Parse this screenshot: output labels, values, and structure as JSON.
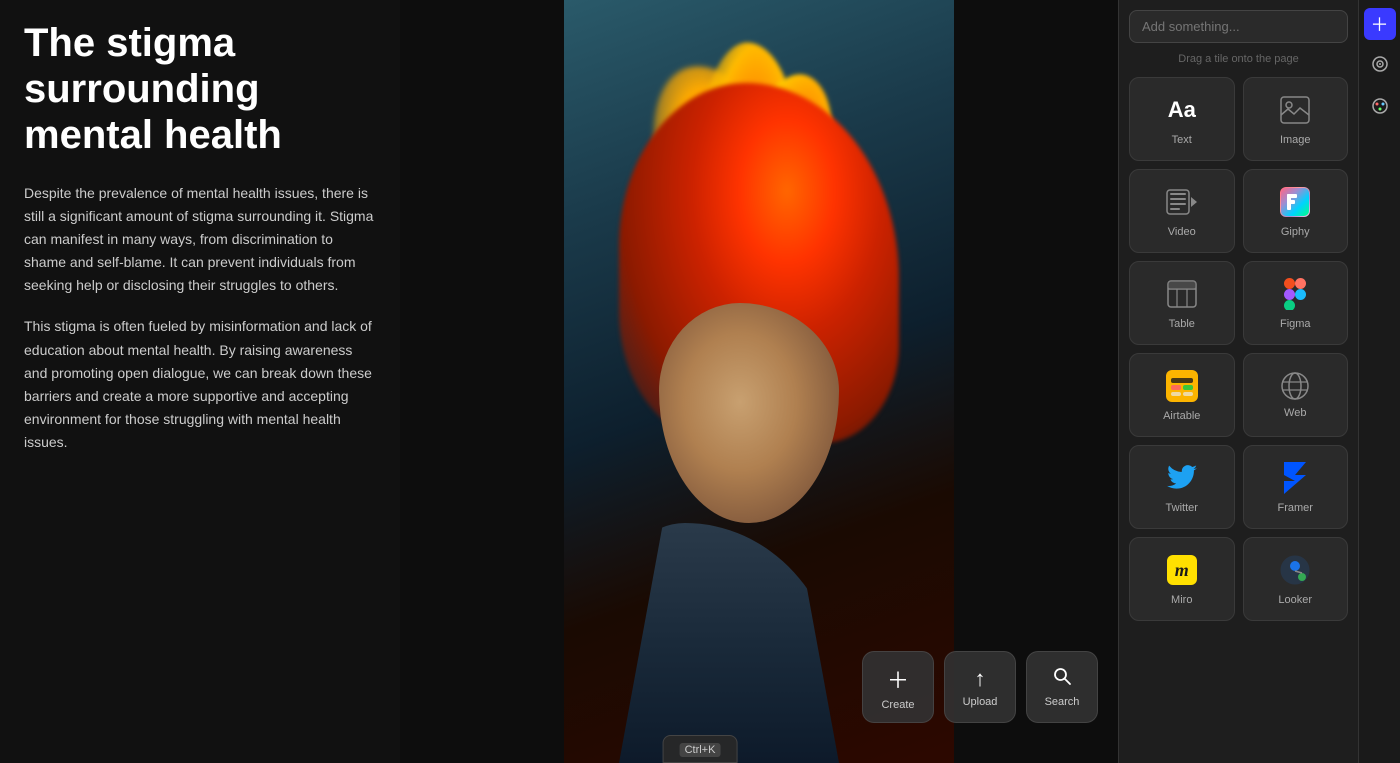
{
  "article": {
    "title": "The stigma surrounding mental health",
    "paragraphs": [
      "Despite the prevalence of mental health issues, there is still a significant amount of stigma surrounding it. Stigma can manifest in many ways, from discrimination to shame and self-blame. It can prevent individuals from seeking help or disclosing their struggles to others.",
      "This stigma is often fueled by misinformation and lack of education about mental health. By raising awareness and promoting open dialogue, we can break down these barriers and create a more supportive and accepting environment for those struggling with mental health issues."
    ]
  },
  "actionButtons": [
    {
      "id": "create",
      "label": "Create",
      "icon": "+"
    },
    {
      "id": "upload",
      "label": "Upload",
      "icon": "↑"
    },
    {
      "id": "search",
      "label": "Search",
      "icon": "🔍"
    }
  ],
  "sidebar": {
    "searchPlaceholder": "Add something...",
    "dragHint": "Drag a tile onto the page",
    "tiles": [
      {
        "id": "text",
        "label": "Text",
        "type": "text"
      },
      {
        "id": "image",
        "label": "Image",
        "type": "image"
      },
      {
        "id": "video",
        "label": "Video",
        "type": "video"
      },
      {
        "id": "giphy",
        "label": "Giphy",
        "type": "giphy"
      },
      {
        "id": "table",
        "label": "Table",
        "type": "table"
      },
      {
        "id": "figma",
        "label": "Figma",
        "type": "figma"
      },
      {
        "id": "airtable",
        "label": "Airtable",
        "type": "airtable"
      },
      {
        "id": "web",
        "label": "Web",
        "type": "web"
      },
      {
        "id": "twitter",
        "label": "Twitter",
        "type": "twitter"
      },
      {
        "id": "framer",
        "label": "Framer",
        "type": "framer"
      },
      {
        "id": "miro",
        "label": "Miro",
        "type": "miro"
      },
      {
        "id": "looker",
        "label": "Looker",
        "type": "looker"
      }
    ]
  },
  "edgeToolbar": {
    "buttons": [
      {
        "id": "plus",
        "icon": "+",
        "active": true
      },
      {
        "id": "circle",
        "icon": "◎",
        "active": false
      },
      {
        "id": "palette",
        "icon": "🎨",
        "active": false
      }
    ]
  },
  "bottomBar": {
    "text": "Ctrl+K",
    "shortcut": "Ctrl+K"
  }
}
